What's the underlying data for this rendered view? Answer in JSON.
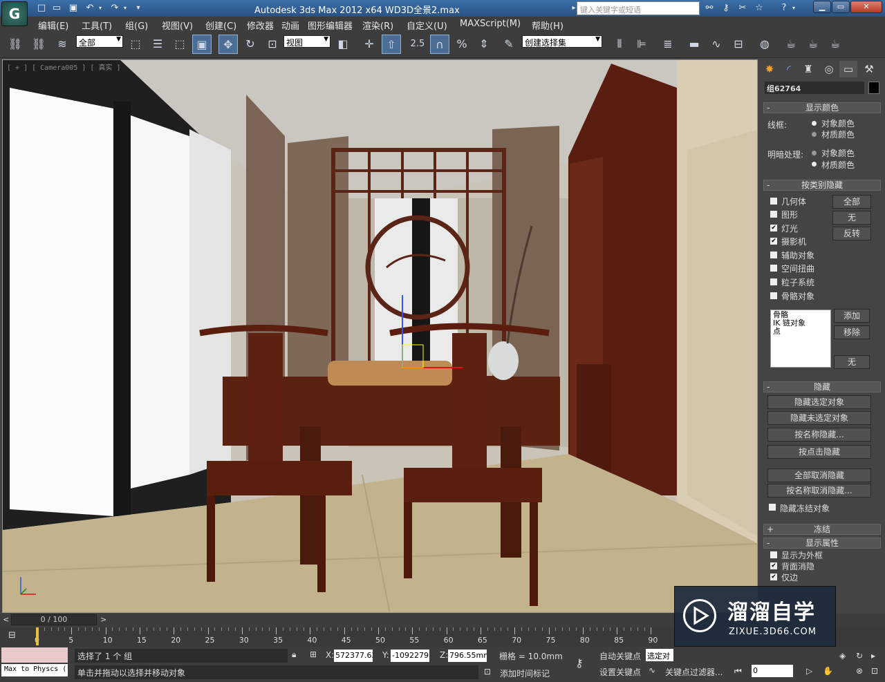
{
  "app": {
    "logo_glyph": "G",
    "title": "Autodesk 3ds Max  2012 x64      WD3D全景2.max",
    "search_placeholder": "键入关键字或短语"
  },
  "menu": [
    "编辑(E)",
    "工具(T)",
    "组(G)",
    "视图(V)",
    "创建(C)",
    "修改器",
    "动画",
    "图形编辑器",
    "渲染(R)",
    "自定义(U)",
    "MAXScript(M)",
    "帮助(H)"
  ],
  "toolbar": {
    "selection_filter": "全部",
    "ref_coord": "视图",
    "named_selection": "创建选择集",
    "snap_label": "2.5"
  },
  "viewport": {
    "label": "[ + ] [ Camera005 ] [ 真实 ]"
  },
  "command_panel": {
    "object_name": "组62764",
    "object_color": "#000000",
    "display_color": {
      "header": "显示颜色",
      "wireframe_label": "线框:",
      "shaded_label": "明暗处理:",
      "opt_object": "对象颜色",
      "opt_material": "材质颜色"
    },
    "hide_by_category": {
      "header": "按类别隐藏",
      "items": [
        {
          "label": "几何体",
          "checked": false
        },
        {
          "label": "图形",
          "checked": false
        },
        {
          "label": "灯光",
          "checked": true
        },
        {
          "label": "摄影机",
          "checked": true
        },
        {
          "label": "辅助对象",
          "checked": false
        },
        {
          "label": "空间扭曲",
          "checked": false
        },
        {
          "label": "粒子系统",
          "checked": false
        },
        {
          "label": "骨骼对象",
          "checked": false
        }
      ],
      "btn_all": "全部",
      "btn_none": "无",
      "btn_invert": "反转",
      "filter_list": [
        "骨骼",
        "IK 链对象",
        "点"
      ],
      "btn_add": "添加",
      "btn_remove": "移除",
      "btn_none2": "无"
    },
    "hide": {
      "header": "隐藏",
      "buttons": [
        "隐藏选定对象",
        "隐藏未选定对象",
        "按名称隐藏...",
        "按点击隐藏",
        "全部取消隐藏",
        "按名称取消隐藏..."
      ],
      "hide_frozen": "隐藏冻结对象"
    },
    "freeze": {
      "header": "冻结"
    },
    "display_props": {
      "header": "显示属性",
      "items": [
        {
          "label": "显示为外框",
          "checked": false
        },
        {
          "label": "背面消隐",
          "checked": true
        },
        {
          "label": "仅边",
          "checked": true
        }
      ]
    }
  },
  "timeline": {
    "frame_display": "0 / 100",
    "ticks": [
      "0",
      "5",
      "10",
      "15",
      "20",
      "25",
      "30",
      "35",
      "40",
      "45",
      "50",
      "55",
      "60",
      "65",
      "70",
      "75",
      "80",
      "85",
      "90"
    ]
  },
  "status": {
    "maxscript": "Max to Physcs (",
    "selection": "选择了 1 个 组",
    "prompt": "单击并拖动以选择并移动对象",
    "x_label": "X:",
    "x_value": "572377.62",
    "y_label": "Y:",
    "y_value": "-1092279.",
    "z_label": "Z:",
    "z_value": "796.55mm",
    "grid": "栅格 = 10.0mm",
    "add_time_tag": "添加时间标记",
    "auto_key": "自动关键点",
    "set_key": "设置关键点",
    "selected": "选定对",
    "key_filters": "关键点过滤器...",
    "frame_value": "0"
  },
  "watermark": {
    "title": "溜溜自学",
    "url": "ZIXUE.3D66.COM"
  }
}
